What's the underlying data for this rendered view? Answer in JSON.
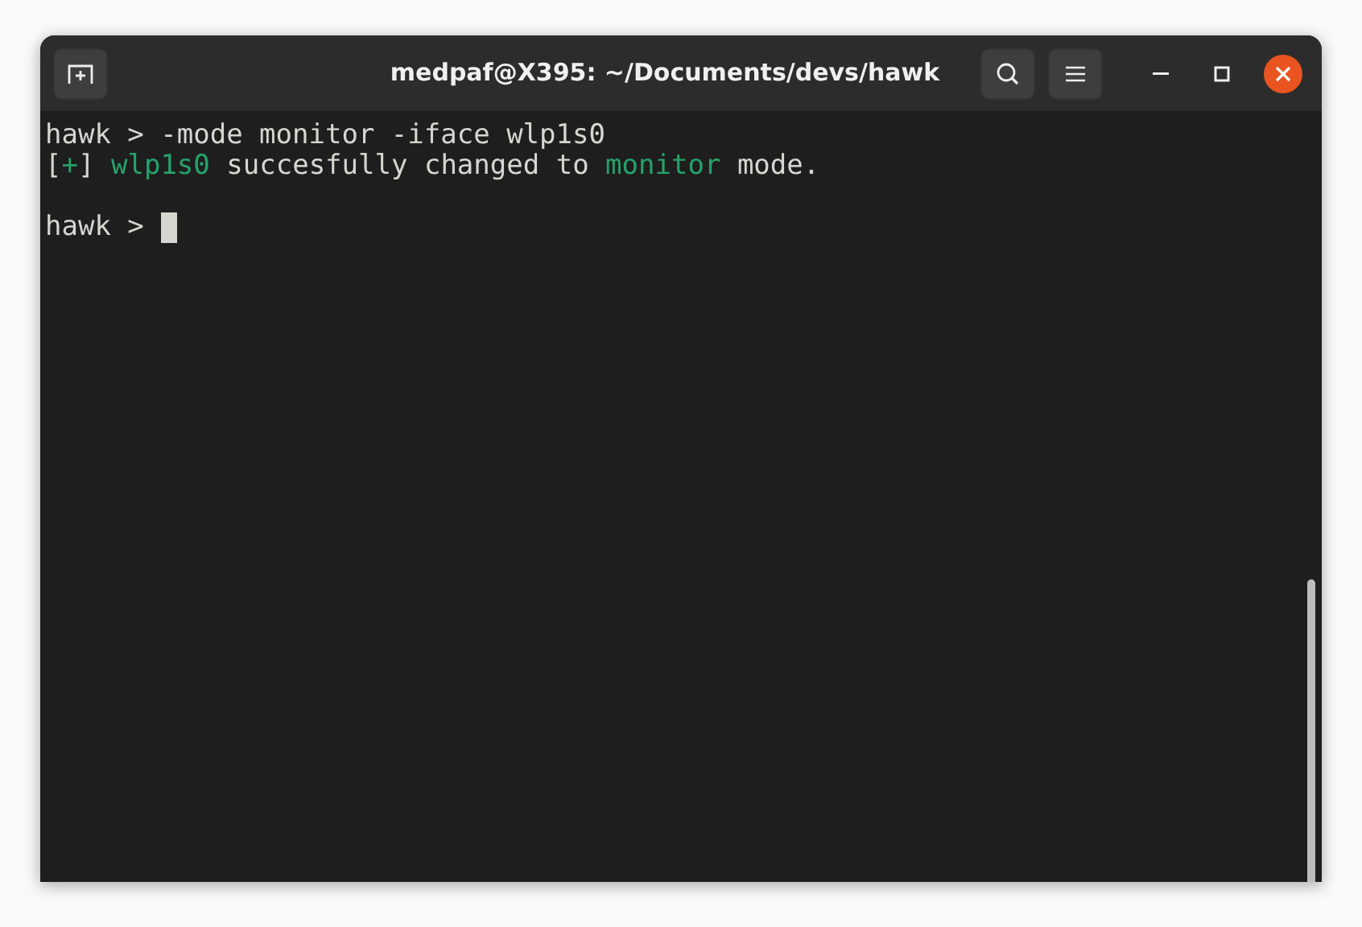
{
  "window": {
    "title": "medpaf@X395: ~/Documents/devs/hawk"
  },
  "terminal": {
    "lines": [
      {
        "kind": "text",
        "segments": [
          {
            "text": "hawk > -mode monitor -iface wlp1s0",
            "color": "#d3d7cf"
          }
        ]
      },
      {
        "kind": "text",
        "segments": [
          {
            "text": "[",
            "color": "#d3d7cf"
          },
          {
            "text": "+",
            "color": "#26a269"
          },
          {
            "text": "] ",
            "color": "#d3d7cf"
          },
          {
            "text": "wlp1s0",
            "color": "#26a269"
          },
          {
            "text": " succesfully changed to ",
            "color": "#d3d7cf"
          },
          {
            "text": "monitor",
            "color": "#26a269"
          },
          {
            "text": " mode.",
            "color": "#d3d7cf"
          }
        ]
      },
      {
        "kind": "blank"
      },
      {
        "kind": "prompt",
        "segments": [
          {
            "text": "hawk > ",
            "color": "#d3d7cf"
          }
        ]
      }
    ]
  }
}
